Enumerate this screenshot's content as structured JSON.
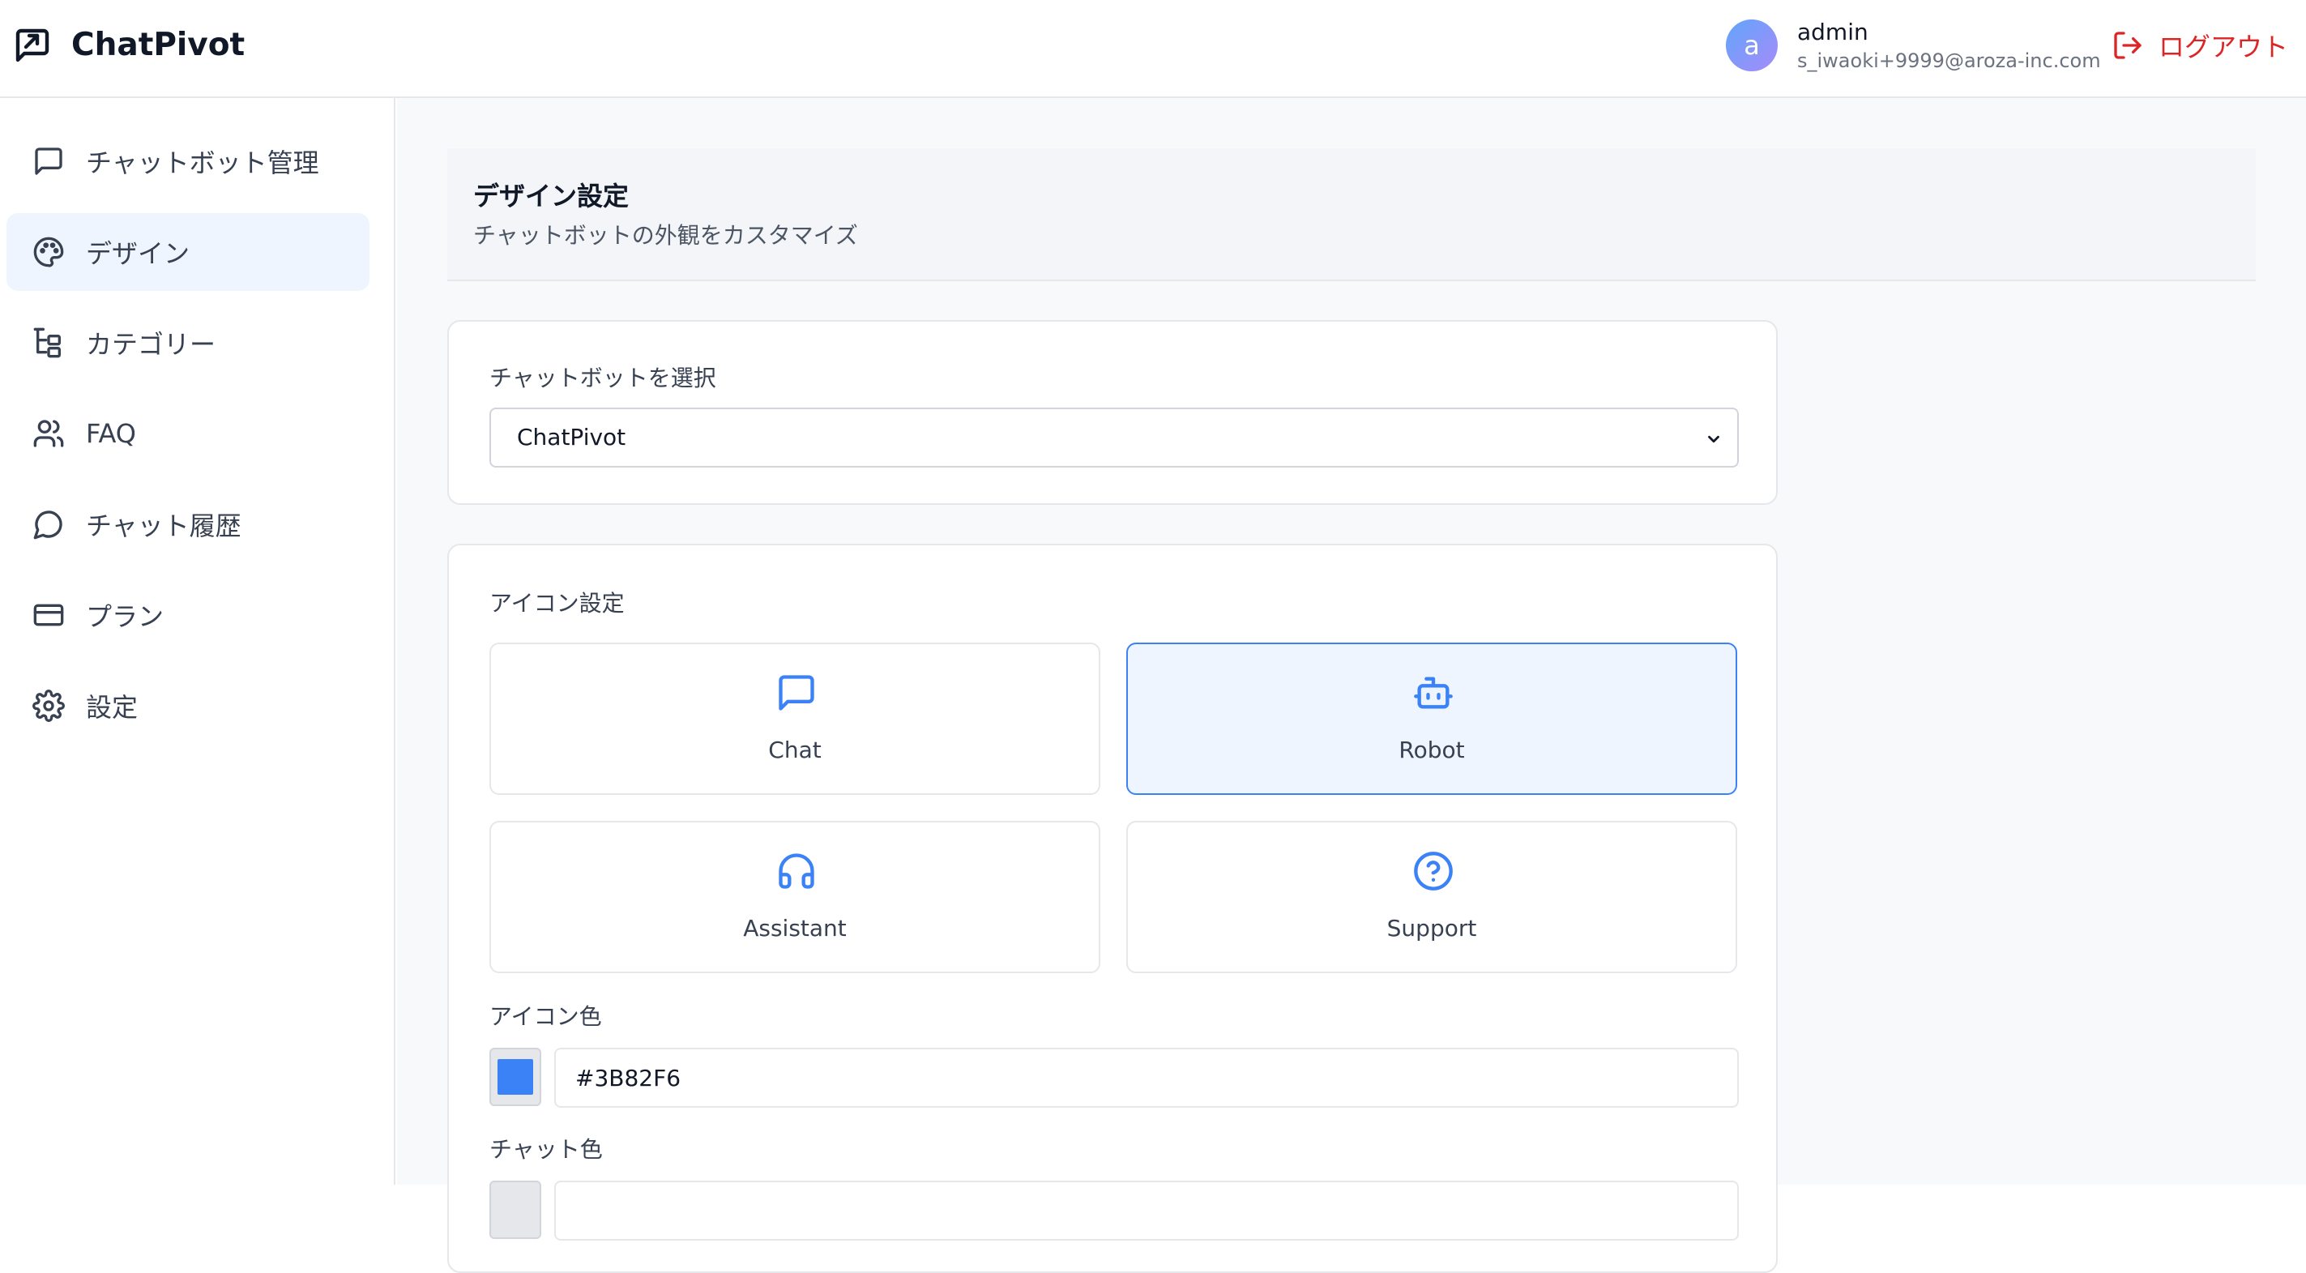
{
  "app": {
    "name": "ChatPivot"
  },
  "user": {
    "initial": "a",
    "name": "admin",
    "email": "s_iwaoki+9999@aroza-inc.com"
  },
  "header": {
    "logout_label": "ログアウト"
  },
  "sidebar": {
    "items": [
      {
        "label": "チャットボット管理",
        "icon": "message-square-icon"
      },
      {
        "label": "デザイン",
        "icon": "palette-icon",
        "active": true
      },
      {
        "label": "カテゴリー",
        "icon": "category-tree-icon"
      },
      {
        "label": "FAQ",
        "icon": "users-icon"
      },
      {
        "label": "チャット履歴",
        "icon": "message-circle-icon"
      },
      {
        "label": "プラン",
        "icon": "credit-card-icon"
      },
      {
        "label": "設定",
        "icon": "gear-icon"
      }
    ]
  },
  "page": {
    "title": "デザイン設定",
    "subtitle": "チャットボットの外観をカスタマイズ"
  },
  "chatbot_select": {
    "label": "チャットボットを選択",
    "value": "ChatPivot"
  },
  "icon_settings": {
    "label": "アイコン設定",
    "options": [
      {
        "label": "Chat",
        "icon": "message-square-icon",
        "selected": false
      },
      {
        "label": "Robot",
        "icon": "robot-icon",
        "selected": true
      },
      {
        "label": "Assistant",
        "icon": "headphones-icon",
        "selected": false
      },
      {
        "label": "Support",
        "icon": "help-circle-icon",
        "selected": false
      }
    ],
    "icon_color_label": "アイコン色",
    "icon_color_value": "#3B82F6",
    "chat_color_label": "チャット色"
  },
  "colors": {
    "accent": "#3b82f6",
    "danger": "#dc2626",
    "active_bg": "#eef5ff"
  }
}
